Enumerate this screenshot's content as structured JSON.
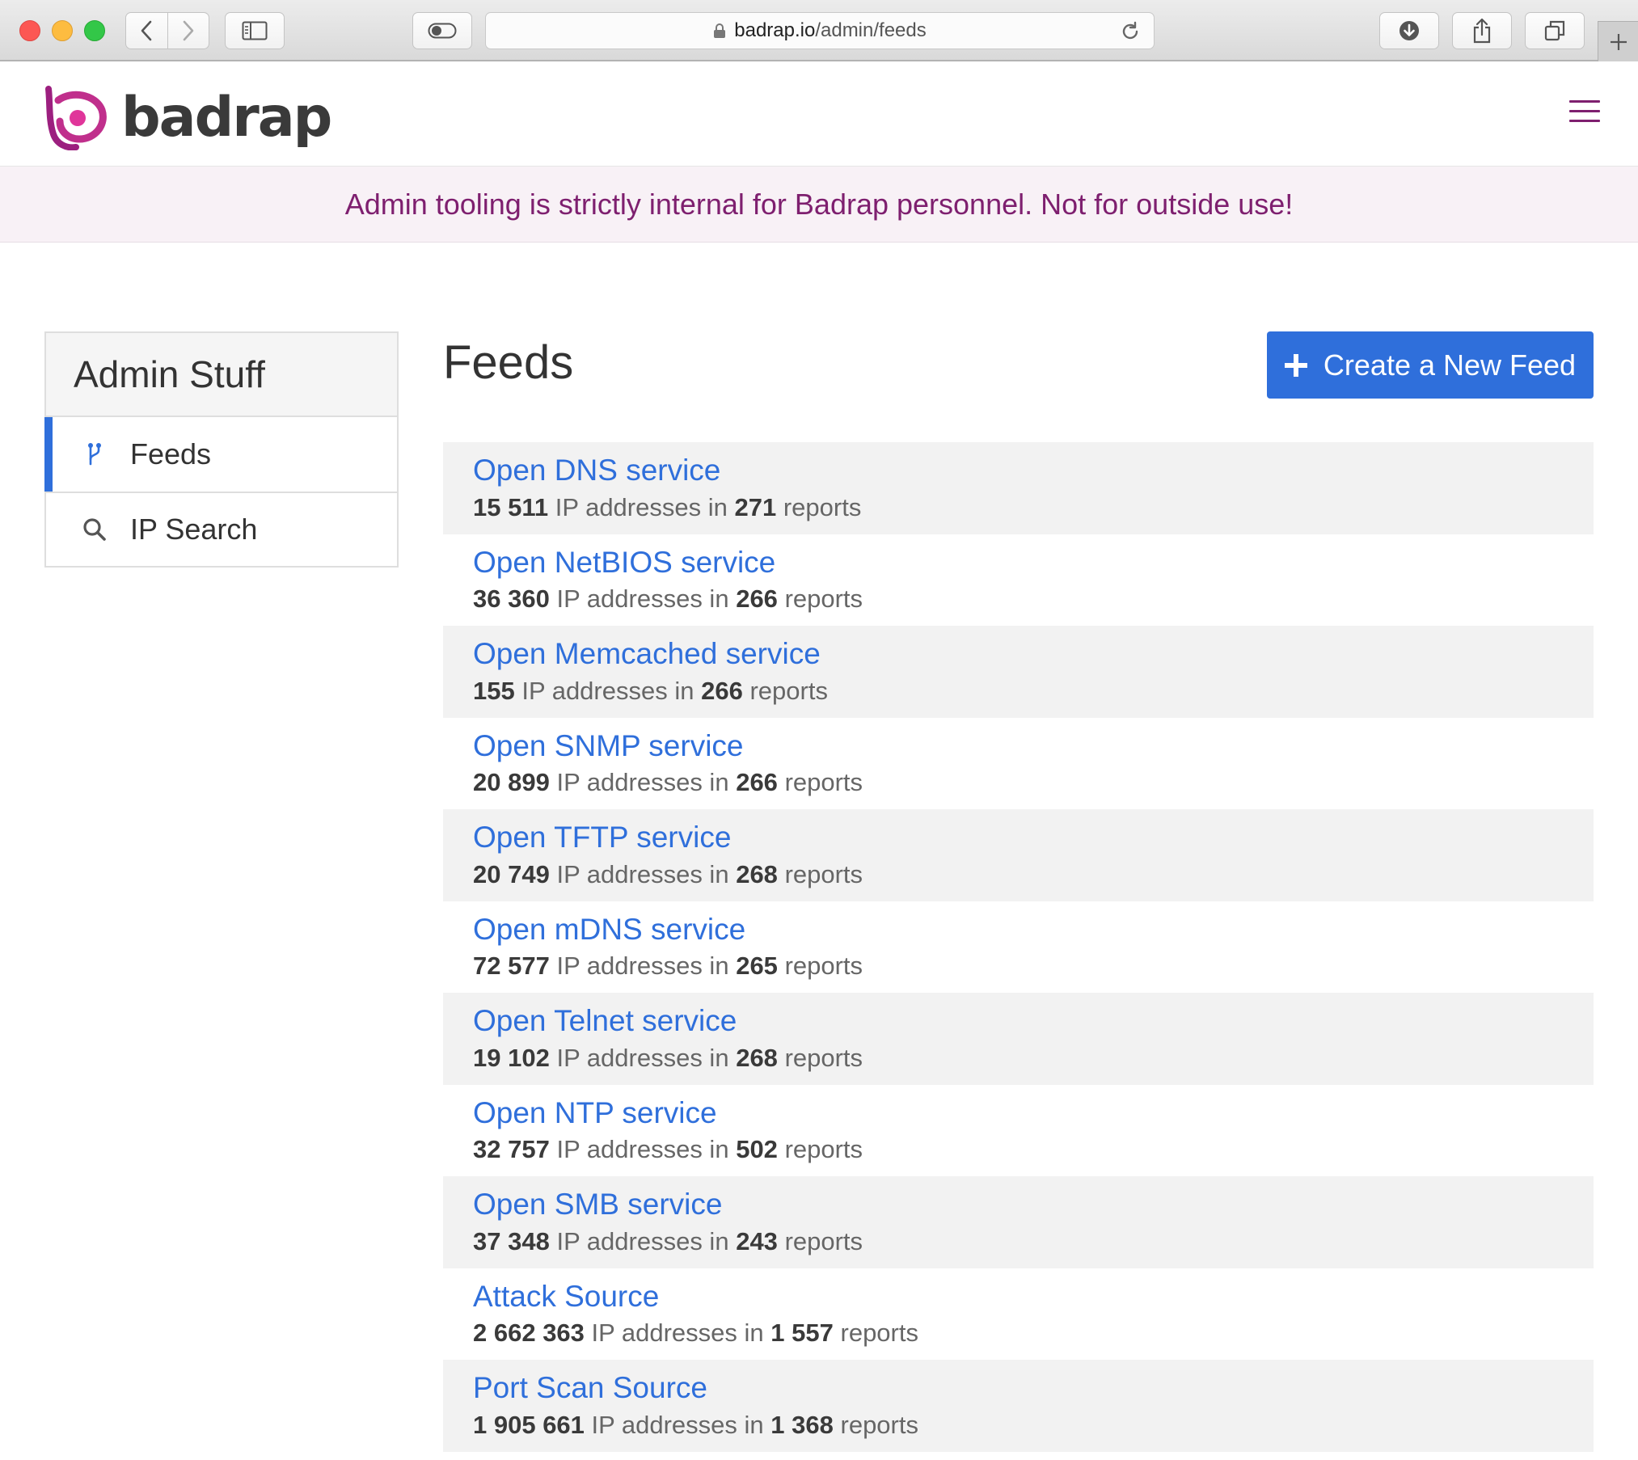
{
  "browser": {
    "url_host": "badrap.io",
    "url_path": "/admin/feeds"
  },
  "site": {
    "brand": "badrap",
    "brand_color": "#7e1f6f",
    "accent_color": "#2f6fdb"
  },
  "banner": {
    "text": "Admin tooling is strictly internal for Badrap personnel. Not for outside use!"
  },
  "sidebar": {
    "title": "Admin Stuff",
    "items": [
      {
        "label": "Feeds",
        "icon": "branch-icon",
        "active": true
      },
      {
        "label": "IP Search",
        "icon": "search-icon",
        "active": false
      }
    ]
  },
  "main": {
    "title": "Feeds",
    "create_button": "Create a New Feed",
    "ip_suffix": "IP addresses in",
    "reports_suffix": "reports",
    "feeds": [
      {
        "name": "Open DNS service",
        "ips": "15 511",
        "reports": "271"
      },
      {
        "name": "Open NetBIOS service",
        "ips": "36 360",
        "reports": "266"
      },
      {
        "name": "Open Memcached service",
        "ips": "155",
        "reports": "266"
      },
      {
        "name": "Open SNMP service",
        "ips": "20 899",
        "reports": "266"
      },
      {
        "name": "Open TFTP service",
        "ips": "20 749",
        "reports": "268"
      },
      {
        "name": "Open mDNS service",
        "ips": "72 577",
        "reports": "265"
      },
      {
        "name": "Open Telnet service",
        "ips": "19 102",
        "reports": "268"
      },
      {
        "name": "Open NTP service",
        "ips": "32 757",
        "reports": "502"
      },
      {
        "name": "Open SMB service",
        "ips": "37 348",
        "reports": "243"
      },
      {
        "name": "Attack Source",
        "ips": "2 662 363",
        "reports": "1 557"
      },
      {
        "name": "Port Scan Source",
        "ips": "1 905 661",
        "reports": "1 368"
      }
    ]
  }
}
